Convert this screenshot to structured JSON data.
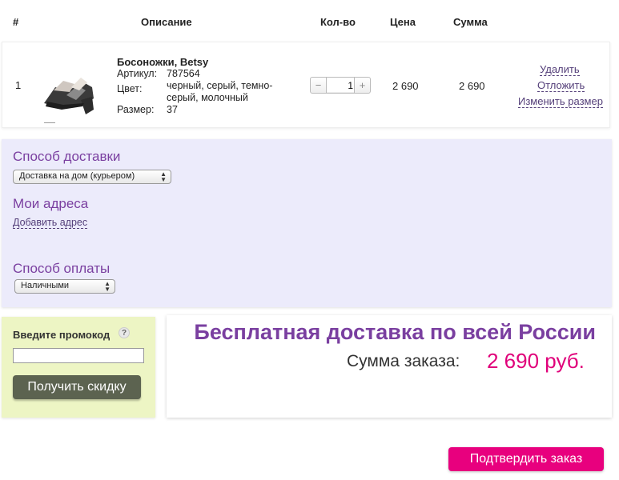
{
  "table_header": {
    "num": "#",
    "description": "Описание",
    "qty": "Кол-во",
    "price": "Цена",
    "sum": "Сумма"
  },
  "item": {
    "num": "1",
    "name": "Босоножки, Betsy",
    "article_label": "Артикул:",
    "article_value": "787564",
    "color_label": "Цвет:",
    "color_value_line1": "черный, серый, темно-",
    "color_value_line2": "серый, молочный",
    "size_label": "Размер:",
    "size_value": "37",
    "qty_minus": "−",
    "qty_value": "1",
    "qty_plus": "+",
    "price": "2 690",
    "sum": "2 690",
    "actions": {
      "delete": "Удалить",
      "postpone": "Отложить",
      "change_size": "Изменить размер"
    }
  },
  "delivery": {
    "method_title": "Способ доставки",
    "method_selected": "Доставка на дом (курьером)",
    "addresses_title": "Мои адреса",
    "add_address": "Добавить адрес",
    "payment_title": "Способ оплаты",
    "payment_selected": "Наличными"
  },
  "promo": {
    "label": "Введите промокод",
    "help": "?",
    "input_value": "",
    "button": "Получить скидку"
  },
  "summary": {
    "free_shipping": "Бесплатная доставка по всей России",
    "total_label": "Сумма заказа:",
    "total_value": "2 690 руб."
  },
  "confirm_button": "Подтвердить заказ",
  "colors": {
    "accent_purple": "#7a3fa0",
    "accent_pink": "#e8007e",
    "delivery_bg": "#ecebfb",
    "promo_bg": "#edf5c4"
  }
}
